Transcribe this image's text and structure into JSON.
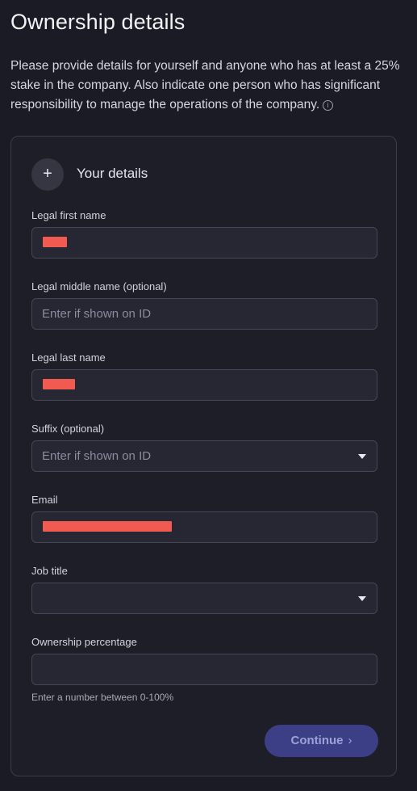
{
  "header": {
    "title": "Ownership details",
    "intro": "Please provide details for yourself and anyone who has at least a 25% stake in the company. Also indicate one person who has significant responsibility to manage the operations of the company."
  },
  "card": {
    "add_symbol": "+",
    "section_title": "Your details",
    "fields": {
      "first_name": {
        "label": "Legal first name",
        "value": ""
      },
      "middle_name": {
        "label": "Legal middle name (optional)",
        "placeholder": "Enter if shown on ID"
      },
      "last_name": {
        "label": "Legal last name",
        "value": ""
      },
      "suffix": {
        "label": "Suffix (optional)",
        "placeholder": "Enter if shown on ID"
      },
      "email": {
        "label": "Email",
        "value": ""
      },
      "job_title": {
        "label": "Job title",
        "value": ""
      },
      "ownership": {
        "label": "Ownership percentage",
        "value": "",
        "hint": "Enter a number between 0-100%"
      }
    },
    "continue_label": "Continue",
    "continue_chevron": "›"
  },
  "icons": {
    "info": "info-circle-icon",
    "add": "plus-icon",
    "dropdown": "caret-down-icon",
    "continue": "chevron-right-icon"
  },
  "colors": {
    "background": "#1a1b24",
    "card": "#1d1e28",
    "input": "#262733",
    "accent_button": "#3d3f86",
    "redaction": "#f05a50"
  }
}
